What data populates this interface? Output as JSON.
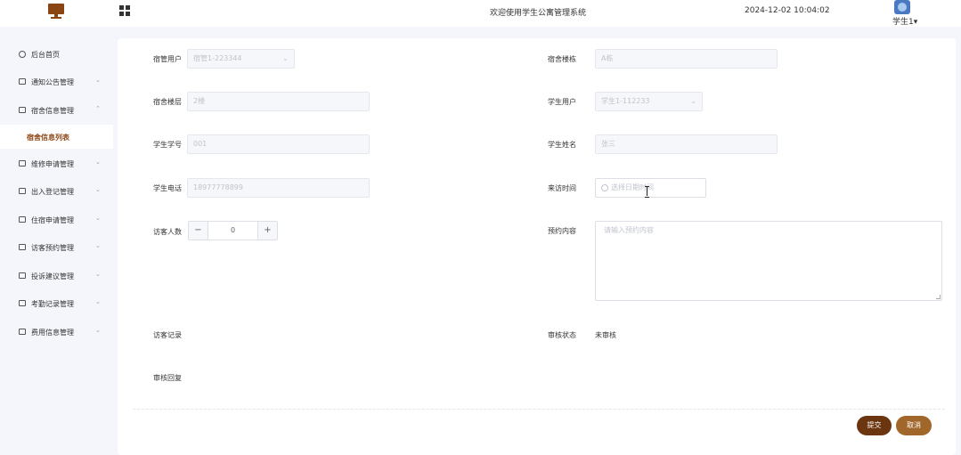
{
  "header": {
    "title": "欢迎使用学生公寓管理系统",
    "datetime": "2024-12-02 10:04:02",
    "user": "学生1",
    "user_caret": "▾",
    "logo_icon": "monitor-icon",
    "menu_toggle_icon": "grid-icon"
  },
  "sidebar": {
    "items": [
      {
        "label": "后台首页",
        "icon": "clock-icon",
        "arrow": ""
      },
      {
        "label": "通知公告管理",
        "icon": "calendar-icon",
        "arrow": "⌄"
      },
      {
        "label": "宿舍信息管理",
        "icon": "calendar-icon",
        "arrow": "⌃"
      },
      {
        "label": "维修申请管理",
        "icon": "calendar-icon",
        "arrow": "⌄"
      },
      {
        "label": "出入登记管理",
        "icon": "calendar-icon",
        "arrow": "⌄"
      },
      {
        "label": "住宿申请管理",
        "icon": "calendar-icon",
        "arrow": "⌄"
      },
      {
        "label": "访客预约管理",
        "icon": "calendar-icon",
        "arrow": "⌄"
      },
      {
        "label": "投诉建议管理",
        "icon": "calendar-icon",
        "arrow": "⌄"
      },
      {
        "label": "考勤记录管理",
        "icon": "calendar-icon",
        "arrow": "⌄"
      },
      {
        "label": "费用信息管理",
        "icon": "calendar-icon",
        "arrow": "⌄"
      }
    ],
    "active_subitem": "宿舍信息列表"
  },
  "form": {
    "dorm_user": {
      "label": "宿管用户",
      "value": "宿管1-223344",
      "arrow": "⌄"
    },
    "dorm_building": {
      "label": "宿舍楼栋",
      "value": "A栋"
    },
    "dorm_floor": {
      "label": "宿舍楼层",
      "value": "2楼"
    },
    "student_user": {
      "label": "学生用户",
      "value": "学生1-112233",
      "arrow": "⌄"
    },
    "student_id": {
      "label": "学生学号",
      "value": "001"
    },
    "student_name": {
      "label": "学生姓名",
      "value": "张三"
    },
    "student_phone": {
      "label": "学生电话",
      "value": "18977778899"
    },
    "visit_time": {
      "label": "来访时间",
      "placeholder": "选择日期时间"
    },
    "visitor_count": {
      "label": "访客人数",
      "value": "0",
      "minus": "−",
      "plus": "+"
    },
    "appointment_content": {
      "label": "预约内容",
      "placeholder": "请输入预约内容"
    },
    "visit_record": {
      "label": "访客记录",
      "value": ""
    },
    "review_status": {
      "label": "审核状态",
      "value": "未审核"
    },
    "review_reply": {
      "label": "审核回复",
      "value": ""
    }
  },
  "buttons": {
    "submit": "提交",
    "cancel": "取消"
  },
  "colors": {
    "accent_dark": "#6b3510",
    "accent": "#a0662a",
    "sidebar_bg": "#f4f6fb",
    "active_text": "#8b4513"
  }
}
